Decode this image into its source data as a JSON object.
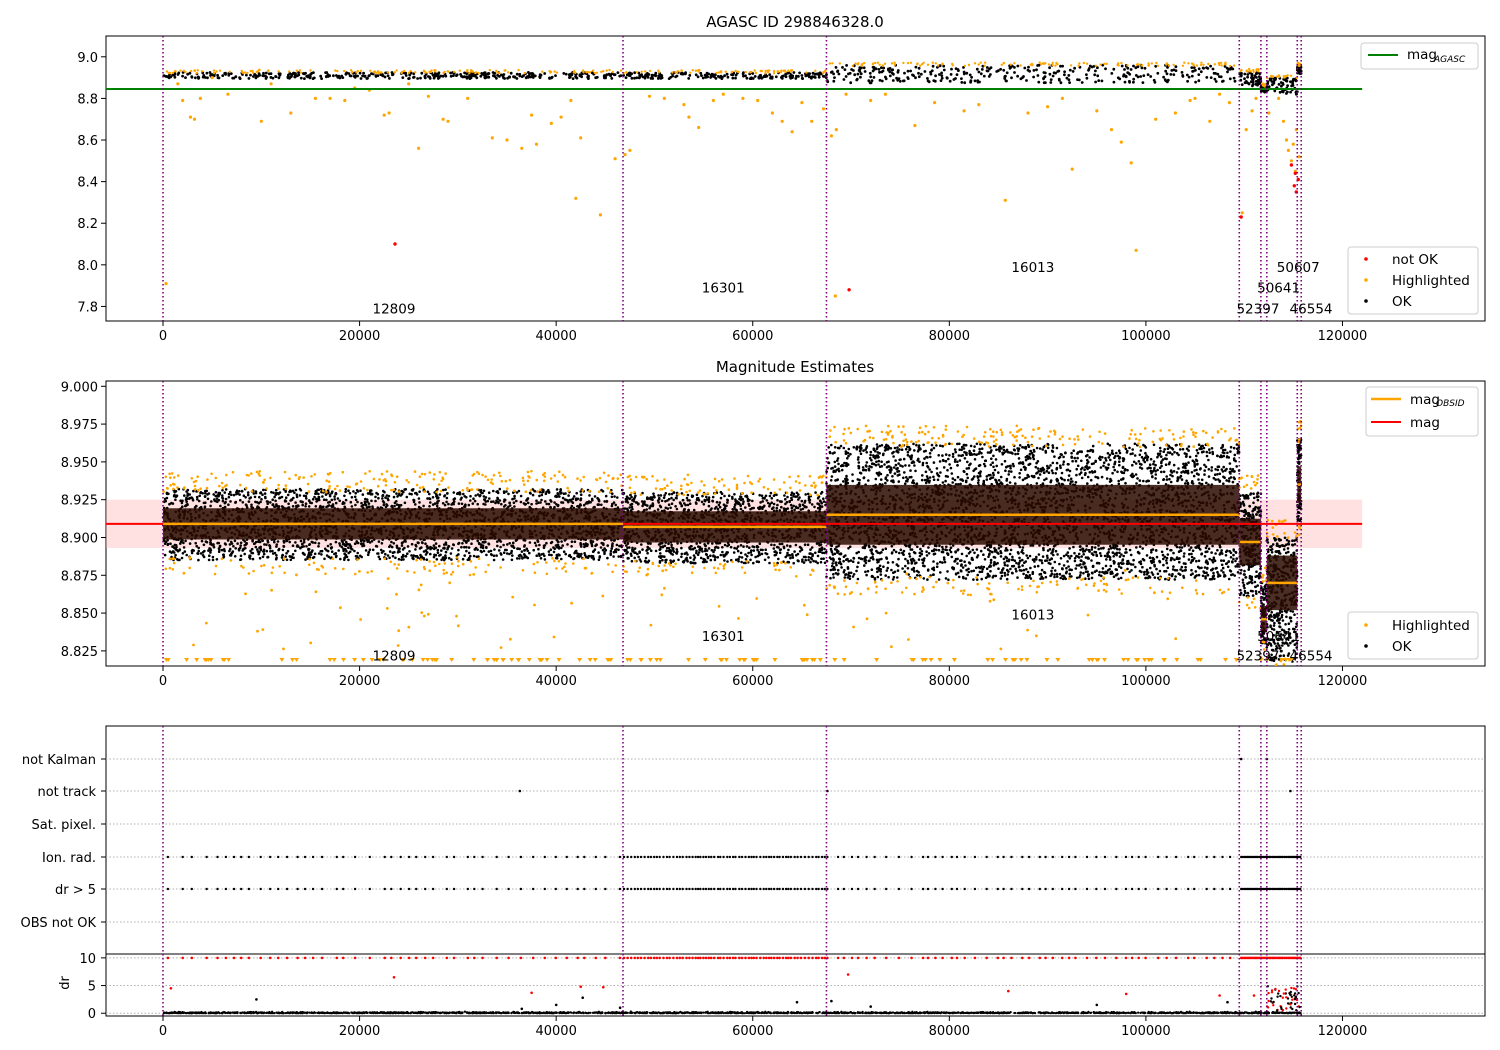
{
  "colors": {
    "ok": "#000000",
    "highlighted": "#ffa500",
    "not_ok": "#ff0000",
    "agasc_line": "#008000",
    "mag_line": "#ff0000",
    "obsid_line": "#ffa500",
    "obs_boundary": "#800080",
    "mag_band": "#ffb3b3",
    "obsid_band": "#2a0a00"
  },
  "chart_data": [
    {
      "type": "scatter",
      "title": "AGASC ID 298846328.0",
      "xlim": [
        -5800,
        134500
      ],
      "ylim": [
        7.73,
        9.1
      ],
      "xticks": [
        0,
        20000,
        40000,
        60000,
        80000,
        100000,
        120000
      ],
      "yticks": [
        7.8,
        8.0,
        8.2,
        8.4,
        8.6,
        8.8,
        9.0
      ],
      "ytick_labels": [
        "7.8",
        "8.0",
        "8.2",
        "8.4",
        "8.6",
        "8.8",
        "9.0"
      ],
      "hline": {
        "name": "mag",
        "sub": "AGASC",
        "y": 8.845,
        "x_range": [
          -5800,
          122000
        ]
      },
      "obs_boundaries": [
        0,
        46800,
        67500,
        109500,
        111700,
        112300,
        115400,
        115800
      ],
      "observations": [
        {
          "label": "12809",
          "x0": 0,
          "x1": 46800,
          "label_x": 23500,
          "label_y": 7.79,
          "band": [
            8.895,
            8.925
          ]
        },
        {
          "label": "16301",
          "x0": 46800,
          "x1": 67500,
          "label_x": 57000,
          "label_y": 7.89,
          "band": [
            8.895,
            8.925
          ]
        },
        {
          "label": "16013",
          "x0": 67500,
          "x1": 109500,
          "label_x": 88500,
          "label_y": 7.99,
          "band": [
            8.875,
            8.96
          ]
        },
        {
          "label": "52397",
          "x0": 109500,
          "x1": 111700,
          "label_x": 111400,
          "label_y": 7.79,
          "band": [
            8.86,
            8.93
          ]
        },
        {
          "label": "50641",
          "x0": 111700,
          "x1": 112300,
          "label_x": 113500,
          "label_y": 7.89,
          "band": [
            8.83,
            8.86
          ]
        },
        {
          "label": "50607",
          "x0": 112300,
          "x1": 115400,
          "label_x": 115500,
          "label_y": 7.99,
          "band": [
            8.82,
            8.9
          ]
        },
        {
          "label": "46554",
          "x0": 115400,
          "x1": 115800,
          "label_x": 116800,
          "label_y": 7.79,
          "band": [
            8.92,
            8.96
          ]
        }
      ],
      "highlighted_outliers": [
        [
          300,
          7.91
        ],
        [
          1500,
          8.87
        ],
        [
          2000,
          8.79
        ],
        [
          2800,
          8.71
        ],
        [
          3200,
          8.7
        ],
        [
          3800,
          8.8
        ],
        [
          5000,
          8.9
        ],
        [
          6600,
          8.82
        ],
        [
          10000,
          8.69
        ],
        [
          11000,
          8.87
        ],
        [
          13000,
          8.73
        ],
        [
          15500,
          8.8
        ],
        [
          17000,
          8.8
        ],
        [
          18500,
          8.79
        ],
        [
          19500,
          8.85
        ],
        [
          21000,
          8.84
        ],
        [
          22500,
          8.72
        ],
        [
          23000,
          8.73
        ],
        [
          25000,
          8.87
        ],
        [
          26000,
          8.56
        ],
        [
          27000,
          8.81
        ],
        [
          28500,
          8.7
        ],
        [
          29000,
          8.69
        ],
        [
          31000,
          8.8
        ],
        [
          33500,
          8.61
        ],
        [
          35000,
          8.6
        ],
        [
          36500,
          8.56
        ],
        [
          37500,
          8.72
        ],
        [
          38000,
          8.58
        ],
        [
          39500,
          8.68
        ],
        [
          40500,
          8.71
        ],
        [
          41500,
          8.79
        ],
        [
          42000,
          8.32
        ],
        [
          42500,
          8.61
        ],
        [
          44500,
          8.24
        ],
        [
          46000,
          8.51
        ],
        [
          47000,
          8.53
        ],
        [
          47500,
          8.55
        ],
        [
          49500,
          8.81
        ],
        [
          51000,
          8.8
        ],
        [
          53000,
          8.77
        ],
        [
          53500,
          8.71
        ],
        [
          54500,
          8.66
        ],
        [
          56000,
          8.79
        ],
        [
          57000,
          8.82
        ],
        [
          59000,
          8.8
        ],
        [
          60500,
          8.79
        ],
        [
          62000,
          8.73
        ],
        [
          63000,
          8.69
        ],
        [
          64000,
          8.64
        ],
        [
          65000,
          8.78
        ],
        [
          66000,
          8.69
        ],
        [
          67200,
          8.75
        ],
        [
          68000,
          8.62
        ],
        [
          68500,
          8.65
        ],
        [
          69500,
          8.82
        ],
        [
          72000,
          8.79
        ],
        [
          73500,
          8.82
        ],
        [
          76500,
          8.67
        ],
        [
          78500,
          8.78
        ],
        [
          81500,
          8.74
        ],
        [
          83000,
          8.77
        ],
        [
          85700,
          8.31
        ],
        [
          88000,
          8.73
        ],
        [
          90000,
          8.76
        ],
        [
          91500,
          8.8
        ],
        [
          92500,
          8.46
        ],
        [
          95000,
          8.74
        ],
        [
          96500,
          8.65
        ],
        [
          97500,
          8.59
        ],
        [
          98500,
          8.49
        ],
        [
          99000,
          8.07
        ],
        [
          101000,
          8.7
        ],
        [
          103000,
          8.73
        ],
        [
          104500,
          8.79
        ],
        [
          105000,
          8.8
        ],
        [
          106500,
          8.69
        ],
        [
          107500,
          8.82
        ],
        [
          108500,
          8.78
        ],
        [
          109800,
          8.25
        ],
        [
          110200,
          8.65
        ],
        [
          110800,
          8.74
        ],
        [
          111200,
          8.8
        ],
        [
          112500,
          8.73
        ],
        [
          113500,
          8.8
        ],
        [
          114000,
          8.69
        ],
        [
          114300,
          8.6
        ],
        [
          114500,
          8.55
        ],
        [
          114800,
          8.5
        ],
        [
          115000,
          8.58
        ],
        [
          115200,
          8.45
        ],
        [
          115300,
          8.65
        ],
        [
          115600,
          8.52
        ],
        [
          68400,
          7.85
        ]
      ],
      "not_ok_points": [
        [
          23600,
          8.1
        ],
        [
          69800,
          7.88
        ],
        [
          109700,
          8.23
        ],
        [
          114800,
          8.48
        ],
        [
          115200,
          8.44
        ],
        [
          115100,
          8.38
        ],
        [
          115300,
          8.35
        ],
        [
          115500,
          8.41
        ]
      ],
      "legend": [
        {
          "label": "not OK",
          "color": "#ff0000"
        },
        {
          "label": "Highlighted",
          "color": "#ffa500"
        },
        {
          "label": "OK",
          "color": "#000000"
        }
      ],
      "top_legend": [
        {
          "label": "mag",
          "sub": "AGASC",
          "color": "#008000"
        }
      ]
    },
    {
      "type": "scatter",
      "title": "Magnitude Estimates",
      "xlim": [
        -5800,
        134500
      ],
      "ylim": [
        8.815,
        9.0035
      ],
      "xticks": [
        0,
        20000,
        40000,
        60000,
        80000,
        100000,
        120000
      ],
      "yticks": [
        8.825,
        8.85,
        8.875,
        8.9,
        8.925,
        8.95,
        8.975,
        9.0
      ],
      "ytick_labels": [
        "8.825",
        "8.850",
        "8.875",
        "8.900",
        "8.925",
        "8.950",
        "8.975",
        "9.000"
      ],
      "mag": {
        "name": "mag",
        "y": 8.909,
        "band": [
          8.893,
          8.925
        ],
        "x_range": [
          -5800,
          122000
        ]
      },
      "obsid_mags": [
        {
          "x0": 0,
          "x1": 46800,
          "y": 8.909
        },
        {
          "x0": 46800,
          "x1": 67500,
          "y": 8.907
        },
        {
          "x0": 67500,
          "x1": 109500,
          "y": 8.915
        },
        {
          "x0": 109500,
          "x1": 111700,
          "y": 8.897
        },
        {
          "x0": 111700,
          "x1": 112300,
          "y": 8.846
        },
        {
          "x0": 112300,
          "x1": 115400,
          "y": 8.87
        },
        {
          "x0": 115400,
          "x1": 115800,
          "y": 8.935
        }
      ],
      "obs_labels": [
        {
          "label": "12809",
          "x": 23500,
          "y": 8.822
        },
        {
          "label": "16301",
          "x": 57000,
          "y": 8.835
        },
        {
          "label": "16013",
          "x": 88500,
          "y": 8.849
        },
        {
          "label": "52397",
          "x": 111400,
          "y": 8.822
        },
        {
          "label": "50641",
          "x": 113500,
          "y": 8.835
        },
        {
          "label": "46554",
          "x": 116800,
          "y": 8.822
        }
      ],
      "legend": [
        {
          "label": "Highlighted",
          "color": "#ffa500"
        },
        {
          "label": "OK",
          "color": "#000000"
        }
      ],
      "top_legend": [
        {
          "label": "mag",
          "sub": "OBSID",
          "color": "#ffa500"
        },
        {
          "label": "mag",
          "sub": "",
          "color": "#ff0000"
        }
      ]
    },
    {
      "type": "scatter",
      "xlim": [
        -5800,
        134500
      ],
      "xticks": [
        0,
        20000,
        40000,
        60000,
        80000,
        100000,
        120000
      ],
      "flag_rows": [
        "not Kalman",
        "not track",
        "Sat. pixel.",
        "Ion. rad.",
        "dr > 5",
        "OBS not OK"
      ],
      "flag_points": {
        "not Kalman": [
          109700,
          112300
        ],
        "not track": [
          36300,
          67600,
          114700
        ],
        "Sat. pixel.": [],
        "OBS not OK": []
      },
      "dr_axis": {
        "label": "dr",
        "ylim": [
          -0.5,
          10.7
        ],
        "yticks": [
          0,
          5,
          10
        ],
        "ytick_labels": [
          "0",
          "5",
          "10"
        ]
      },
      "dr_outliers": [
        [
          800,
          4.5
        ],
        [
          9500,
          2.5
        ],
        [
          23500,
          6.5
        ],
        [
          36500,
          0.8
        ],
        [
          37500,
          3.7
        ],
        [
          40000,
          1.5
        ],
        [
          42500,
          4.8
        ],
        [
          42700,
          2.8
        ],
        [
          44800,
          4.7
        ],
        [
          46500,
          1.0
        ],
        [
          64500,
          2.0
        ],
        [
          68000,
          2.2
        ],
        [
          69700,
          7.0
        ],
        [
          72000,
          1.2
        ],
        [
          86000,
          4.0
        ],
        [
          95000,
          1.5
        ],
        [
          98000,
          3.5
        ],
        [
          107500,
          3.2
        ],
        [
          108300,
          2.0
        ],
        [
          111000,
          3.2
        ]
      ]
    }
  ]
}
